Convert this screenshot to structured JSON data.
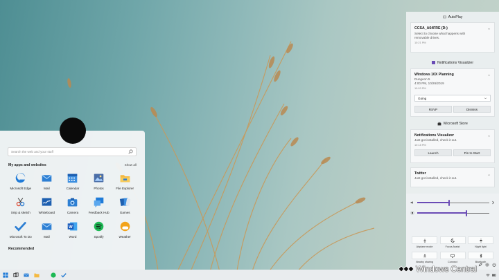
{
  "start_menu": {
    "search_placeholder": "Search the web and your stuff",
    "apps_heading": "My apps and websites",
    "show_all": "Show all",
    "recommended_heading": "Recommended",
    "apps": [
      {
        "label": "Microsoft Edge",
        "icon": "edge-icon"
      },
      {
        "label": "Mail",
        "icon": "mail-icon"
      },
      {
        "label": "Calendar",
        "icon": "calendar-icon"
      },
      {
        "label": "Photos",
        "icon": "photos-icon"
      },
      {
        "label": "File Explorer",
        "icon": "folder-icon"
      },
      {
        "label": "Snip & sketch",
        "icon": "snip-icon"
      },
      {
        "label": "Whiteboard",
        "icon": "whiteboard-icon"
      },
      {
        "label": "Camera",
        "icon": "camera-icon"
      },
      {
        "label": "Feedback Hub",
        "icon": "feedback-icon"
      },
      {
        "label": "Games",
        "icon": "games-icon"
      },
      {
        "label": "Microsoft To Do",
        "icon": "todo-icon"
      },
      {
        "label": "Mail",
        "icon": "mail-icon"
      },
      {
        "label": "Word",
        "icon": "word-icon"
      },
      {
        "label": "Spotify",
        "icon": "spotify-icon"
      },
      {
        "label": "Weather",
        "icon": "weather-icon"
      }
    ]
  },
  "action_center": {
    "autoplay": {
      "header": "AutoPlay",
      "title": "CCSA_A64FRE (D:)",
      "line1": "Select to choose what happens with",
      "line2": "removable drives.",
      "time": "10:21 PM"
    },
    "visualizer": {
      "header": "Notifications Visualizer",
      "title": "Windows 10X Planning",
      "line1": "Dungeon 5",
      "line2": "4:00 PM, 10/26/2019",
      "time": "10:03 PM",
      "select_value": "Going",
      "rsvp": "RSVP",
      "dismiss": "Dismiss"
    },
    "store": {
      "header": "Microsoft Store",
      "title": "Notifications Visualizer",
      "line1": "Just got installed, check it out.",
      "time": "10:18 PM",
      "launch": "Launch",
      "pin": "Pin to Start"
    },
    "twitter": {
      "title": "Twitter",
      "line1": "Just got installed, check it out."
    },
    "volume_level": 0.44,
    "brightness_level": 0.68,
    "tiles": [
      {
        "label": "Airplane mode",
        "icon": "airplane-icon"
      },
      {
        "label": "Focus Assist",
        "icon": "moon-icon"
      },
      {
        "label": "Night light",
        "icon": "sun-icon"
      },
      {
        "label": "Nearby sharing",
        "icon": "share-icon"
      },
      {
        "label": "Connect",
        "icon": "cast-icon"
      },
      {
        "label": "Bluetooth",
        "icon": "bluetooth-icon"
      }
    ]
  },
  "watermark": "Windows Central",
  "colors": {
    "accent": "#6a4bb5",
    "edge_blue": "#1f7bd8",
    "spotify": "#1db954",
    "weather": "#f2a31b"
  }
}
